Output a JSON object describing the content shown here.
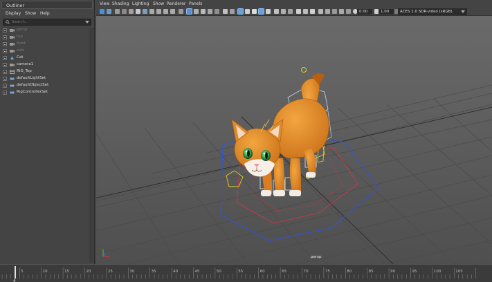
{
  "outliner": {
    "title": "Outliner",
    "menu": [
      "Display",
      "Show",
      "Help"
    ],
    "search_placeholder": "Search...",
    "items": [
      {
        "label": "persp",
        "icon": "camera-icon",
        "dim": true
      },
      {
        "label": "top",
        "icon": "camera-icon",
        "dim": true
      },
      {
        "label": "front",
        "icon": "camera-icon",
        "dim": true
      },
      {
        "label": "side",
        "icon": "camera-icon",
        "dim": true
      },
      {
        "label": "Cat",
        "icon": "mesh-icon",
        "dim": false
      },
      {
        "label": "camera1",
        "icon": "camera-icon",
        "dim": false
      },
      {
        "label": "RIG_Top",
        "icon": "group-icon",
        "dim": false
      },
      {
        "label": "defaultLightSet",
        "icon": "set-icon",
        "dim": false
      },
      {
        "label": "defaultObjectSet",
        "icon": "set-icon",
        "dim": false
      },
      {
        "label": "RigControllerSet",
        "icon": "set-icon",
        "dim": false
      }
    ]
  },
  "viewport": {
    "menu": [
      "View",
      "Shading",
      "Lighting",
      "Show",
      "Renderer",
      "Panels"
    ],
    "exposure": "0.00",
    "gamma": "1.00",
    "color_space": "ACES 1.0 SDR-video (sRGB)",
    "camera_label": "persp"
  },
  "timeline": {
    "ticks": [
      "5",
      "10",
      "15",
      "20",
      "25",
      "30",
      "35",
      "40",
      "45",
      "50",
      "55",
      "60",
      "65",
      "70",
      "75",
      "80",
      "85",
      "90",
      "95",
      "100",
      "105"
    ],
    "current_frame": "4"
  }
}
